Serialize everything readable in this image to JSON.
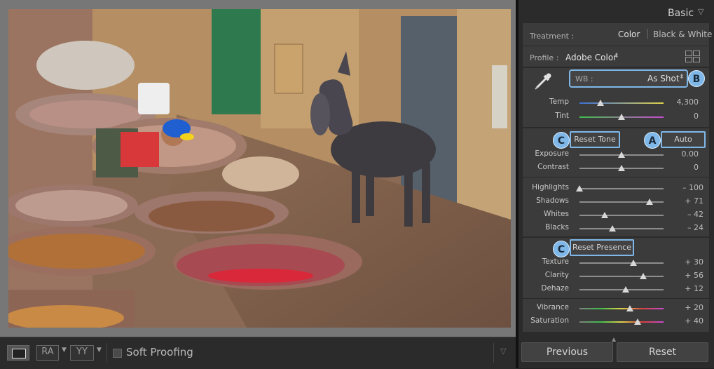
{
  "panel": {
    "title": "Basic",
    "treatment_label": "Treatment :",
    "treatment_color": "Color",
    "treatment_bw": "Black & White",
    "profile_label": "Profile :",
    "profile_value": "Adobe Color",
    "wb_label": "WB :",
    "wb_value": "As Shot",
    "reset_tone": "Reset Tone",
    "auto": "Auto",
    "reset_presence": "Reset Presence",
    "callout_a": "A",
    "callout_b": "B",
    "callout_c1": "C",
    "callout_c2": "C"
  },
  "sliders": {
    "temp": {
      "label": "Temp",
      "value": "4,300",
      "position": 0.25
    },
    "tint": {
      "label": "Tint",
      "value": "0",
      "position": 0.5
    },
    "exposure": {
      "label": "Exposure",
      "value": "0.00",
      "position": 0.5
    },
    "contrast": {
      "label": "Contrast",
      "value": "0",
      "position": 0.5
    },
    "highlights": {
      "label": "Highlights",
      "value": "– 100",
      "position": 0.0
    },
    "shadows": {
      "label": "Shadows",
      "value": "+ 71",
      "position": 0.83
    },
    "whites": {
      "label": "Whites",
      "value": "– 42",
      "position": 0.3
    },
    "blacks": {
      "label": "Blacks",
      "value": "– 24",
      "position": 0.39
    },
    "texture": {
      "label": "Texture",
      "value": "+ 30",
      "position": 0.64
    },
    "clarity": {
      "label": "Clarity",
      "value": "+ 56",
      "position": 0.76
    },
    "dehaze": {
      "label": "Dehaze",
      "value": "+ 12",
      "position": 0.55
    },
    "vibrance": {
      "label": "Vibrance",
      "value": "+ 20",
      "position": 0.6
    },
    "saturation": {
      "label": "Saturation",
      "value": "+ 40",
      "position": 0.69
    }
  },
  "footer": {
    "previous": "Previous",
    "reset": "Reset"
  },
  "toolbar": {
    "ra_label": "RA",
    "yy_label": "YY",
    "soft_proofing": "Soft Proofing"
  },
  "colors": {
    "highlight": "#7fb8e8",
    "panel_bg": "#2b2b2b",
    "section_bg": "#3b3b3b"
  }
}
